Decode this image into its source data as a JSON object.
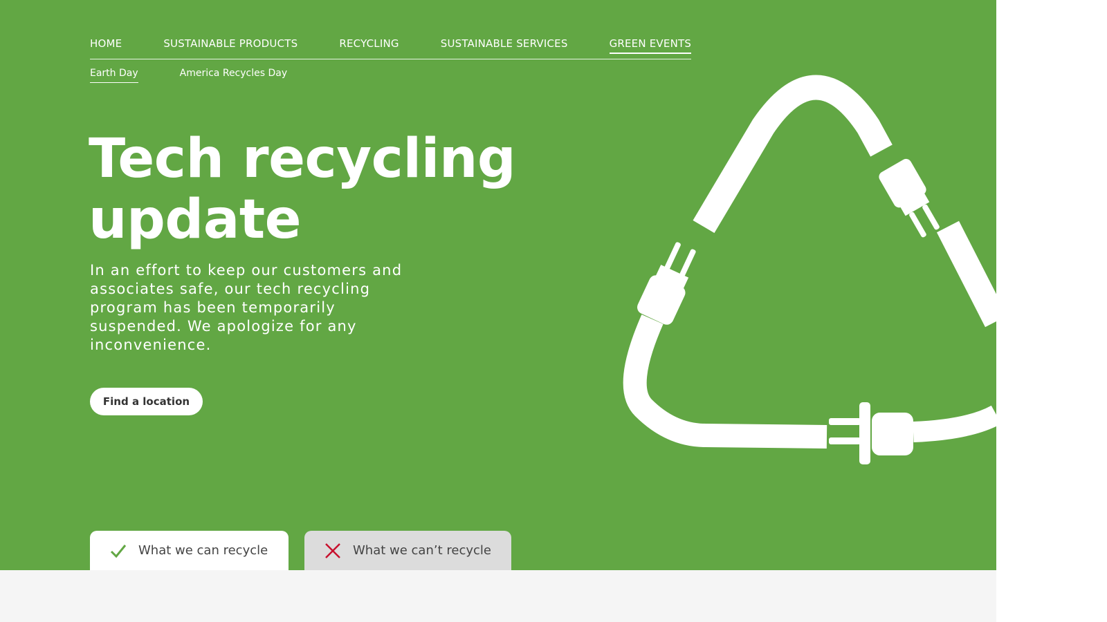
{
  "nav": {
    "items": [
      {
        "label": "HOME",
        "active": false
      },
      {
        "label": "SUSTAINABLE PRODUCTS",
        "active": false
      },
      {
        "label": "RECYCLING",
        "active": false
      },
      {
        "label": "SUSTAINABLE SERVICES",
        "active": false
      },
      {
        "label": "GREEN EVENTS",
        "active": true
      }
    ]
  },
  "subnav": {
    "items": [
      {
        "label": "Earth Day",
        "active": true
      },
      {
        "label": "America Recycles Day",
        "active": false
      }
    ]
  },
  "hero": {
    "title_line1": "Tech recycling",
    "title_line2": "update",
    "description": "In an effort to keep our customers and associates safe, our tech recycling program has been temporarily suspended. We apologize for any inconvenience.",
    "cta_label": "Find a location",
    "illustration_icon": "recycle-plugs-icon"
  },
  "tabs": [
    {
      "label": "What we can recycle",
      "icon": "check-icon",
      "selected": true
    },
    {
      "label": "What we can’t recycle",
      "icon": "x-icon",
      "selected": false
    }
  ],
  "colors": {
    "brand_green": "#62a744",
    "check_green": "#62a744",
    "x_red": "#c8102e",
    "tab_inactive": "#dcdcdc",
    "lower_bg": "#f5f5f5"
  }
}
